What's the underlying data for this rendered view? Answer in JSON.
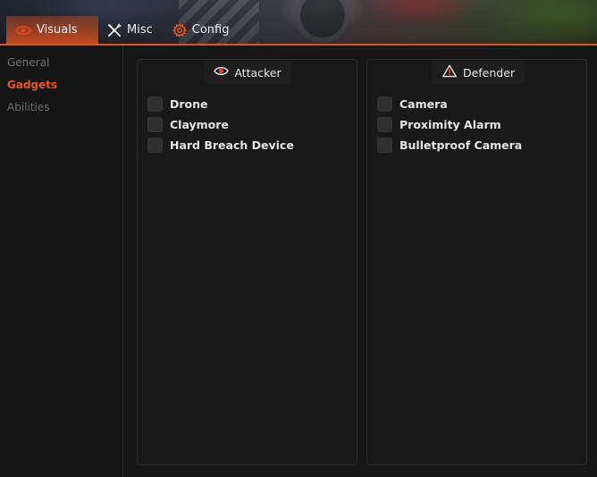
{
  "tabs": [
    {
      "label": "Visuals",
      "icon": "eye-icon",
      "active": true
    },
    {
      "label": "Misc",
      "icon": "tools-icon",
      "active": false
    },
    {
      "label": "Config",
      "icon": "gear-icon",
      "active": false
    }
  ],
  "sidebar": {
    "items": [
      {
        "label": "General",
        "active": false
      },
      {
        "label": "Gadgets",
        "active": true
      },
      {
        "label": "Abilities",
        "active": false
      }
    ]
  },
  "panels": {
    "attacker": {
      "title": "Attacker",
      "icon": "eye-icon",
      "items": [
        {
          "label": "Drone",
          "checked": false
        },
        {
          "label": "Claymore",
          "checked": false
        },
        {
          "label": "Hard Breach Device",
          "checked": false
        }
      ]
    },
    "defender": {
      "title": "Defender",
      "icon": "warning-icon",
      "items": [
        {
          "label": "Camera",
          "checked": false
        },
        {
          "label": "Proximity Alarm",
          "checked": false
        },
        {
          "label": "Bulletproof Camera",
          "checked": false
        }
      ]
    }
  },
  "colors": {
    "accent": "#e0521f",
    "background": "#161616",
    "panel": "#191919",
    "checkbox": "#303030",
    "inactive_text": "#6f6f6f"
  }
}
